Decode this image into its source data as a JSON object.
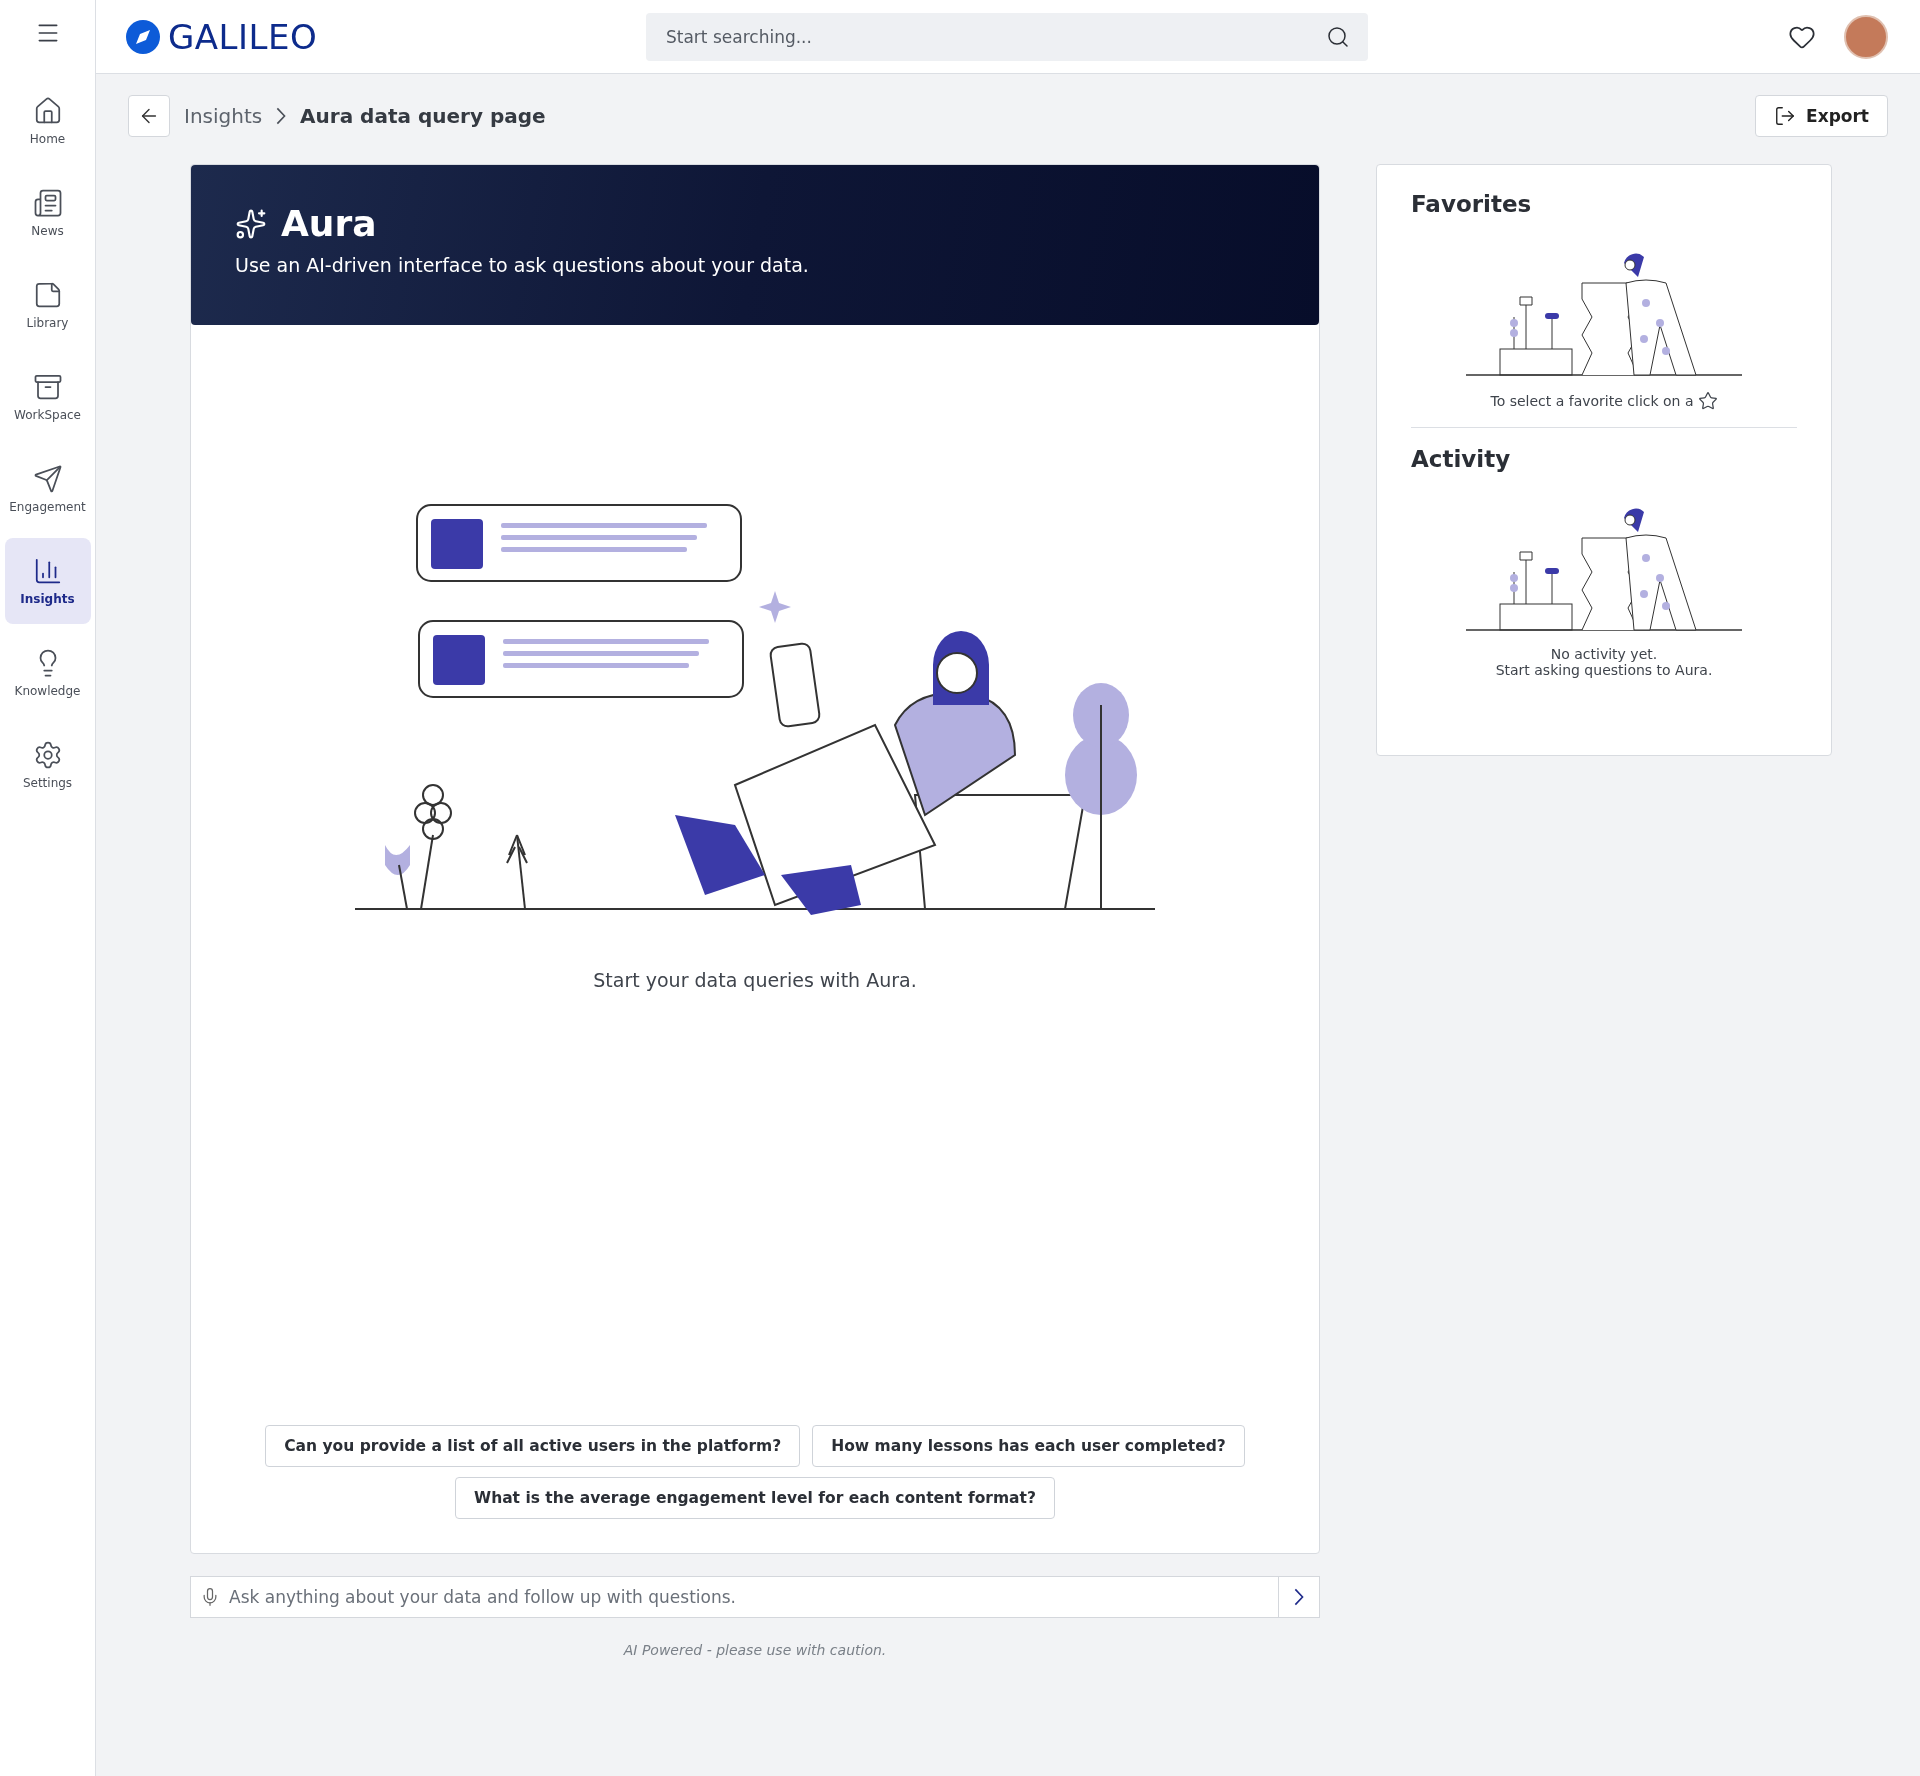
{
  "brand": {
    "name": "GALILEO"
  },
  "search": {
    "placeholder": "Start searching..."
  },
  "sidebar": {
    "items": [
      {
        "label": "Home",
        "selected": false
      },
      {
        "label": "News",
        "selected": false
      },
      {
        "label": "Library",
        "selected": false
      },
      {
        "label": "WorkSpace",
        "selected": false
      },
      {
        "label": "Engagement",
        "selected": false
      },
      {
        "label": "Insights",
        "selected": true
      },
      {
        "label": "Knowledge",
        "selected": false
      },
      {
        "label": "Settings",
        "selected": false
      }
    ]
  },
  "breadcrumb": {
    "items": [
      "Insights",
      "Aura data query page"
    ]
  },
  "export_button": {
    "label": "Export"
  },
  "hero": {
    "title": "Aura",
    "subtitle": "Use an AI-driven interface to ask questions about your data."
  },
  "empty_state": {
    "message": "Start your data queries with Aura."
  },
  "suggestions": [
    "Can you provide a list of all active users in the platform?",
    "How many lessons has each user completed?",
    "What is the average engagement level for each content format?"
  ],
  "query_input": {
    "placeholder": "Ask anything about your data and follow up with questions."
  },
  "disclaimer": "AI Powered - please use with caution.",
  "favorites": {
    "title": "Favorites",
    "hint": "To select a favorite click on a"
  },
  "activity": {
    "title": "Activity",
    "lines": [
      "No activity yet.",
      "Start asking questions to Aura."
    ]
  }
}
